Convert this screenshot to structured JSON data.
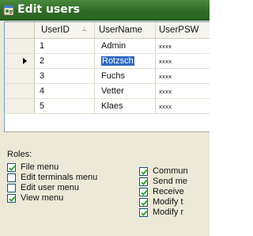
{
  "window": {
    "title": "Edit users",
    "icon": "app-icon"
  },
  "grid": {
    "columns": [
      "UserID",
      "UserName",
      "UserPSW"
    ],
    "sorted_column": "UserID",
    "selected_row": 1,
    "rows": [
      {
        "id": "1",
        "name": "Admin",
        "password": "xxxx"
      },
      {
        "id": "2",
        "name": "Rotzsch",
        "password": "xxxx"
      },
      {
        "id": "3",
        "name": "Fuchs",
        "password": "xxxx"
      },
      {
        "id": "4",
        "name": "Vetter",
        "password": "xxxx"
      },
      {
        "id": "5",
        "name": "Klaes",
        "password": "xxxx"
      }
    ]
  },
  "roles": {
    "label": "Roles:",
    "left": [
      {
        "label": "File menu",
        "checked": true
      },
      {
        "label": "Edit terminals menu",
        "checked": false
      },
      {
        "label": "Edit user menu",
        "checked": false
      },
      {
        "label": "View menu",
        "checked": true
      }
    ],
    "right": [
      {
        "label": "Commun",
        "checked": true
      },
      {
        "label": "Send me",
        "checked": true
      },
      {
        "label": "Receive",
        "checked": true
      },
      {
        "label": "Modify t",
        "checked": true
      },
      {
        "label": "Modify r",
        "checked": true
      }
    ]
  },
  "colors": {
    "titlebar": "#2f6b26",
    "selection": "#316ac5"
  }
}
